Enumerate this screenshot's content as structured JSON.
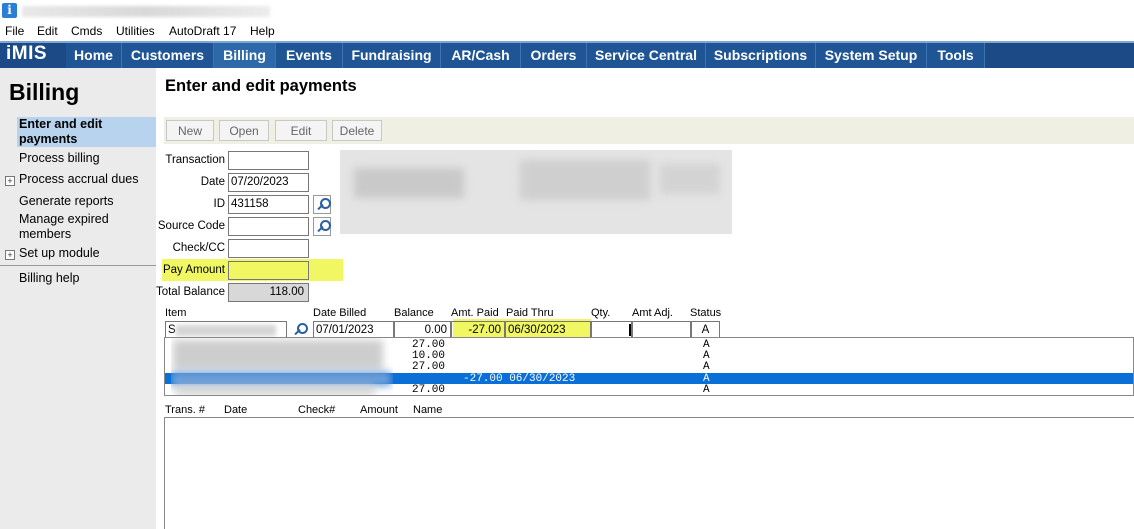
{
  "menu": [
    "File",
    "Edit",
    "Cmds",
    "Utilities",
    "AutoDraft 17",
    "Help"
  ],
  "logo": "iMIS",
  "nav": [
    "Home",
    "Customers",
    "Billing",
    "Events",
    "Fundraising",
    "AR/Cash",
    "Orders",
    "Service Central",
    "Subscriptions",
    "System Setup",
    "Tools"
  ],
  "sidebar": {
    "title": "Billing",
    "items": [
      "Enter and edit payments",
      "Process billing",
      "Process accrual dues",
      "Generate reports",
      "Manage expired members",
      "Set up module",
      "Billing help"
    ]
  },
  "page_title": "Enter and edit payments",
  "toolbar": [
    "New",
    "Open",
    "Edit",
    "Delete"
  ],
  "form": {
    "transaction_label": "Transaction",
    "transaction_value": "",
    "date_label": "Date",
    "date_value": "07/20/2023",
    "id_label": "ID",
    "id_value": "431158",
    "source_label": "Source Code",
    "source_value": "",
    "check_label": "Check/CC",
    "check_value": "",
    "pay_label": "Pay Amount",
    "pay_value": "",
    "total_label": "Total Balance",
    "total_value": "118.00"
  },
  "grid_headers": [
    "Item",
    "Date Billed",
    "Balance",
    "Amt. Paid",
    "Paid Thru",
    "Qty.",
    "Amt Adj.",
    "Status"
  ],
  "edit_row": {
    "item": "S",
    "date_billed": "07/01/2023",
    "balance": "0.00",
    "amt_paid": "-27.00",
    "paid_thru": "06/30/2023",
    "qty": "",
    "amt_adj": "",
    "status": "A"
  },
  "rows": [
    {
      "balance": "27.00",
      "paid": "",
      "status": "A"
    },
    {
      "balance": "10.00",
      "paid": "",
      "status": "A"
    },
    {
      "balance": "27.00",
      "paid": "",
      "status": "A"
    },
    {
      "balance": "",
      "paid": "-27.00 06/30/2023",
      "status": "A"
    },
    {
      "balance": "27.00",
      "paid": "",
      "status": "A"
    }
  ],
  "lower_headers": [
    "Trans. #",
    "Date",
    "Check#",
    "Amount",
    "Name"
  ],
  "colors": {
    "nav_bg": "#1c4a86",
    "highlight": "#f0f763",
    "selected_row": "#0a6fd6",
    "sidebar_active": "#b7d3ee"
  }
}
